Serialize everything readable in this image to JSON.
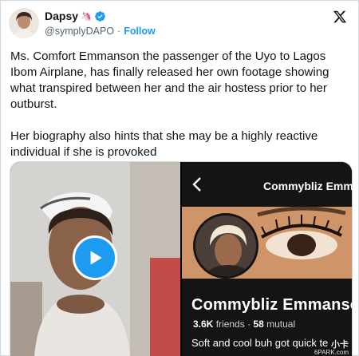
{
  "author": {
    "name": "Dapsy",
    "name_suffix_emoji": "🦄",
    "handle": "@symplyDAPO",
    "separator": "·",
    "follow_label": "Follow"
  },
  "tweet": {
    "text": "Ms. Comfort Emmanson the passenger of the Uyo to Lagos Ibom Airplane, has finally released her own footage showing what transpired between her and the air hostess prior to her outburst.\n\nHer biography also hints that she may be a highly reactive individual if she is provoked"
  },
  "media": {
    "profile_header_name": "Commybliz Emm",
    "profile_name": "Commybliz Emmanso",
    "friends_count": "3.6K",
    "friends_label": "friends",
    "stats_separator": "·",
    "mutual_count": "58",
    "mutual_label": "mutual",
    "bio": "Soft and cool buh got quick te",
    "watermark_line1": "小卡",
    "watermark_line2": "6PARK.com"
  },
  "colors": {
    "accent": "#1d9bf0",
    "text": "#0f1419",
    "secondary": "#536471"
  },
  "icons": {
    "x_logo": "x-logo-icon",
    "verified": "verified-badge-icon",
    "play": "play-icon",
    "back": "back-arrow-icon"
  }
}
